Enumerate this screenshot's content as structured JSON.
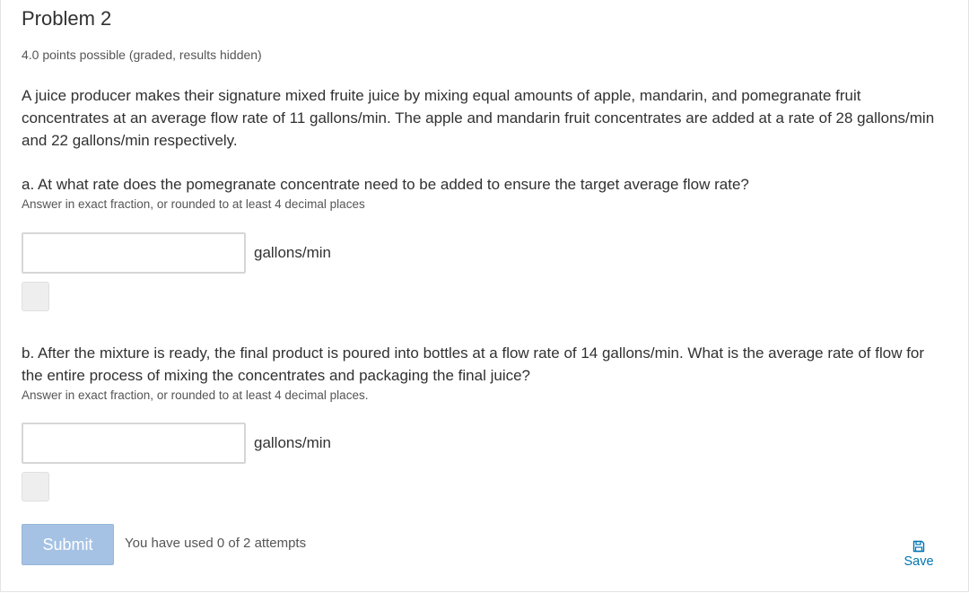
{
  "problem": {
    "title": "Problem 2",
    "points": "4.0 points possible (graded, results hidden)",
    "text": "A juice producer makes their signature mixed fruite juice by mixing equal amounts of apple, mandarin, and pomegranate fruit concentrates at an average flow rate of 11 gallons/min. The apple and mandarin fruit concentrates are added at a rate of 28 gallons/min and 22 gallons/min respectively."
  },
  "part_a": {
    "question": "a. At what rate does the pomegranate concentrate need to be added to ensure the target average flow rate?",
    "hint": "Answer in exact fraction, or rounded to at least 4 decimal places",
    "input_value": "",
    "unit": "gallons/min"
  },
  "part_b": {
    "question": "b. After the mixture is ready, the final product is poured into bottles at a flow rate of 14 gallons/min. What is the average rate of flow for the entire process of mixing the concentrates and packaging the final juice?",
    "hint": "Answer in exact fraction, or rounded to at least 4 decimal places.",
    "input_value": "",
    "unit": "gallons/min"
  },
  "actions": {
    "submit_label": "Submit",
    "attempts_text": "You have used 0 of 2 attempts",
    "save_label": "Save",
    "save_icon": "floppy-disk-icon"
  },
  "colors": {
    "submit_bg": "#a5c2e4",
    "link": "#0075b4",
    "text": "#313131"
  }
}
